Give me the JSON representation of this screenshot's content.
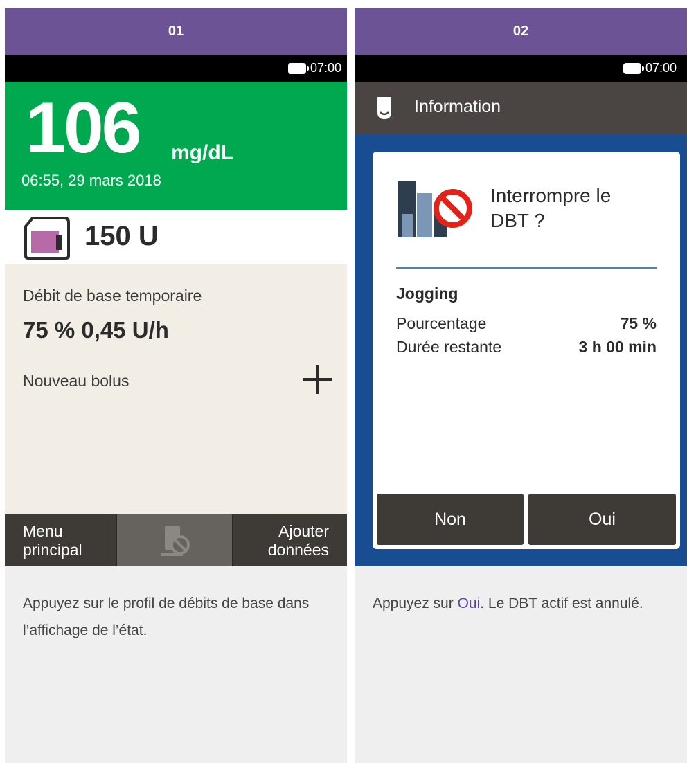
{
  "steps": [
    {
      "number": "01",
      "status": {
        "time": "07:00"
      },
      "glucose": {
        "value": "106",
        "unit": "mg/dL",
        "datetime": "06:55, 29 mars 2018"
      },
      "reservoir": {
        "amount": "150 U"
      },
      "tbr": {
        "label": "Débit de base temporaire",
        "value": "75 % 0,45 U/h"
      },
      "bolus": {
        "label": "Nouveau bolus"
      },
      "bottom_bar": {
        "menu_line1": "Menu",
        "menu_line2": "principal",
        "add_line1": "Ajouter",
        "add_line2": "données"
      },
      "caption": "Appuyez sur le profil de débits de base dans l’affichage de l’état."
    },
    {
      "number": "02",
      "status": {
        "time": "07:00"
      },
      "title": "Information",
      "dialog": {
        "question_line1": "Interrompre le",
        "question_line2": "DBT ?",
        "profile_name": "Jogging",
        "rows": [
          {
            "label": "Pourcentage",
            "value": "75 %"
          },
          {
            "label": "Durée restante",
            "value": "3 h 00 min"
          }
        ],
        "no_label": "Non",
        "yes_label": "Oui"
      },
      "caption": {
        "before": "Appuyez sur ",
        "link": "Oui",
        "after": ". Le DBT actif est annulé."
      }
    }
  ],
  "colors": {
    "header": "#6b5395",
    "glucose_ok": "#00a94f",
    "info_bg": "#f2ede5",
    "dialog_area": "#184d92",
    "button_dark": "#3e3a36",
    "accent_link": "#5e45a8"
  }
}
